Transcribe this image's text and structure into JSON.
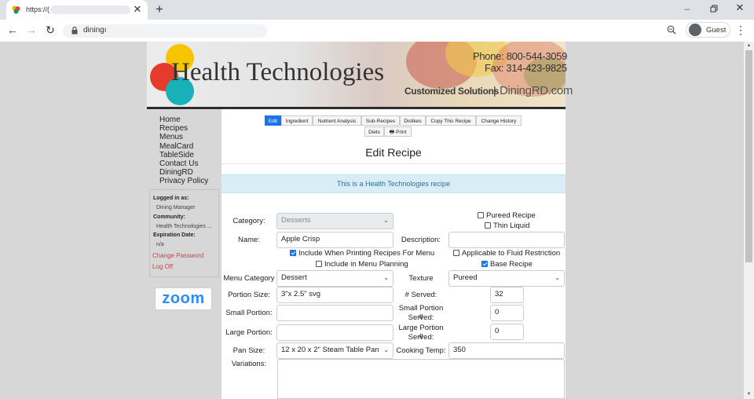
{
  "browser": {
    "tab_title": "https://(",
    "url": "diningı",
    "profile": "Guest"
  },
  "banner": {
    "brand": "Health Technologies",
    "phone": "Phone: 800-544-3059",
    "fax": "Fax: 314-423-9825",
    "tagline": "Customized Solutions",
    "separator": "|",
    "site": "DiningRD.com"
  },
  "nav": [
    "Home",
    "Recipes",
    "Menus",
    "MealCard",
    "TableSide",
    "Contact Us",
    "DiningRD",
    "Privacy Policy"
  ],
  "login": {
    "logged_in_label": "Logged in as:",
    "logged_in_value": "Dining Manager",
    "community_label": "Community:",
    "community_value": "Health Technologies ...",
    "expiration_label": "Expiration Date:",
    "expiration_value": "n/a",
    "change_password": "Change Password",
    "log_off": "Log Off"
  },
  "zoom_logo": "zoom",
  "tabs": [
    "Edit",
    "Ingredient",
    "Nutrient Analysis",
    "Sub-Recipes",
    "Dislikes",
    "Copy This Recipe",
    "Change History",
    "Diets",
    "Print"
  ],
  "page_title": "Edit Recipe",
  "info_banner": "This is a Health Technologies recipe",
  "form": {
    "category_label": "Category:",
    "category_value": "Desserts",
    "pureed_recipe": "Pureed Recipe",
    "thin_liquid": "Thin Liquid",
    "name_label": "Name:",
    "name_value": "Apple Crisp",
    "description_label": "Description:",
    "description_value": "",
    "include_printing": "Include When Printing Recipes For Menu",
    "include_planning": "Include in Menu Planning",
    "fluid_restriction": "Applicable to Fluid Restriction",
    "base_recipe": "Base Recipe",
    "menu_category_label": "Menu Category",
    "menu_category_value": "Dessert",
    "texture_label": "Texture",
    "texture_value": "Pureed",
    "portion_size_label": "Portion Size:",
    "portion_size_value": "3\"x 2.5\" svg",
    "served_label": "# Served:",
    "served_value": "32",
    "small_portion_label": "Small Portion:",
    "small_portion_value": "",
    "small_served_label_1": "Small Portion #",
    "small_served_label_2": "Served:",
    "small_served_value": "0",
    "large_portion_label": "Large Portion:",
    "large_portion_value": "",
    "large_served_label_1": "Large Portion #",
    "large_served_label_2": "Served:",
    "large_served_value": "0",
    "pan_size_label": "Pan Size:",
    "pan_size_value": "12 x 20 x 2\" Steam Table Pan",
    "cooking_temp_label": "Cooking Temp:",
    "cooking_temp_value": "350",
    "variations_label": "Variations:",
    "variations_value": ""
  },
  "colors": {
    "accent": "#1a73e8",
    "info_bg": "#d9edf7",
    "info_text": "#31708f",
    "link_red": "#b94a48",
    "zoom_blue": "#2d8cff"
  }
}
